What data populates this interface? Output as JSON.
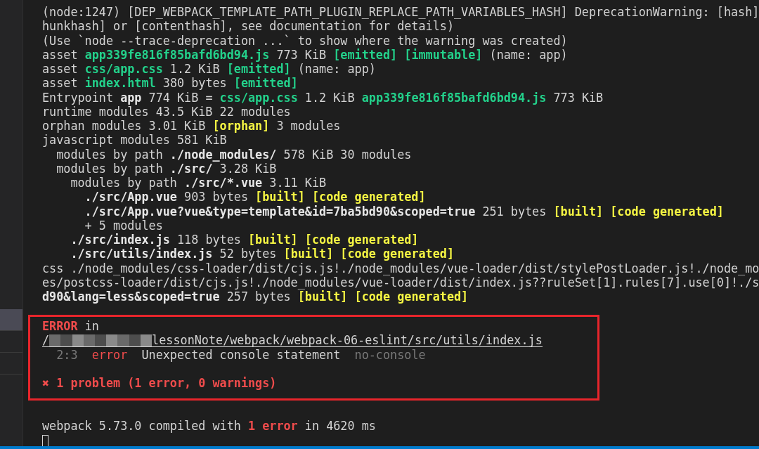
{
  "sidebar": {
    "items": [
      {
        "selected": true
      },
      {
        "selected": false
      },
      {
        "selected": false
      }
    ]
  },
  "terminal": {
    "output": [
      {
        "segments": [
          {
            "text": "(node:1247) [DEP_WEBPACK_TEMPLATE_PATH_PLUGIN_REPLACE_PATH_VARIABLES_HASH] DeprecationWarning: [hash]",
            "kind": "plain"
          }
        ]
      },
      {
        "segments": [
          {
            "text": "hunkhash] or [contenthash], see documentation for details)",
            "kind": "plain"
          }
        ]
      },
      {
        "segments": [
          {
            "text": "(Use `node --trace-deprecation ...` to show where the warning was created)",
            "kind": "plain"
          }
        ]
      },
      {
        "segments": [
          {
            "text": "asset ",
            "kind": "plain"
          },
          {
            "text": "app339fe816f85bafd6bd94.js",
            "kind": "green"
          },
          {
            "text": " 773 KiB ",
            "kind": "plain"
          },
          {
            "text": "[emitted] [immutable]",
            "kind": "green"
          },
          {
            "text": " (name: app)",
            "kind": "plain"
          }
        ]
      },
      {
        "segments": [
          {
            "text": "asset ",
            "kind": "plain"
          },
          {
            "text": "css/app.css",
            "kind": "green"
          },
          {
            "text": " 1.2 KiB ",
            "kind": "plain"
          },
          {
            "text": "[emitted]",
            "kind": "green"
          },
          {
            "text": " (name: app)",
            "kind": "plain"
          }
        ]
      },
      {
        "segments": [
          {
            "text": "asset ",
            "kind": "plain"
          },
          {
            "text": "index.html",
            "kind": "green"
          },
          {
            "text": " 380 bytes ",
            "kind": "plain"
          },
          {
            "text": "[emitted]",
            "kind": "green"
          }
        ]
      },
      {
        "segments": [
          {
            "text": "Entrypoint ",
            "kind": "plain"
          },
          {
            "text": "app",
            "kind": "bold"
          },
          {
            "text": " 774 KiB = ",
            "kind": "plain"
          },
          {
            "text": "css/app.css",
            "kind": "green"
          },
          {
            "text": " 1.2 KiB ",
            "kind": "plain"
          },
          {
            "text": "app339fe816f85bafd6bd94.js",
            "kind": "green"
          },
          {
            "text": " 773 KiB",
            "kind": "plain"
          }
        ]
      },
      {
        "segments": [
          {
            "text": "runtime modules 43.5 KiB 22 modules",
            "kind": "plain"
          }
        ]
      },
      {
        "segments": [
          {
            "text": "orphan modules 3.01 KiB ",
            "kind": "plain"
          },
          {
            "text": "[orphan]",
            "kind": "yellow"
          },
          {
            "text": " 3 modules",
            "kind": "plain"
          }
        ]
      },
      {
        "segments": [
          {
            "text": "javascript modules 581 KiB",
            "kind": "plain"
          }
        ],
        "children": [
          {
            "segments": [
              {
                "text": "modules by path ",
                "kind": "plain"
              },
              {
                "text": "./node_modules/",
                "kind": "bold"
              },
              {
                "text": " 578 KiB 30 modules",
                "kind": "plain"
              }
            ]
          },
          {
            "segments": [
              {
                "text": "modules by path ",
                "kind": "plain"
              },
              {
                "text": "./src/",
                "kind": "bold"
              },
              {
                "text": " 3.28 KiB",
                "kind": "plain"
              }
            ],
            "children": [
              {
                "segments": [
                  {
                    "text": "modules by path ",
                    "kind": "plain"
                  },
                  {
                    "text": "./src/*.vue",
                    "kind": "bold"
                  },
                  {
                    "text": " 3.11 KiB",
                    "kind": "plain"
                  }
                ],
                "children": [
                  {
                    "segments": [
                      {
                        "text": "./src/App.vue",
                        "kind": "bold"
                      },
                      {
                        "text": " 903 bytes ",
                        "kind": "plain"
                      },
                      {
                        "text": "[built] [code generated]",
                        "kind": "yellow"
                      }
                    ]
                  },
                  {
                    "segments": [
                      {
                        "text": "./src/App.vue?vue&type=template&id=7ba5bd90&scoped=true",
                        "kind": "bold"
                      },
                      {
                        "text": " 251 bytes ",
                        "kind": "plain"
                      },
                      {
                        "text": "[built] [code generated]",
                        "kind": "yellow"
                      }
                    ]
                  },
                  {
                    "segments": [
                      {
                        "text": "+ 5 modules",
                        "kind": "plain"
                      }
                    ]
                  }
                ]
              },
              {
                "segments": [
                  {
                    "text": "./src/index.js",
                    "kind": "bold"
                  },
                  {
                    "text": " 118 bytes ",
                    "kind": "plain"
                  },
                  {
                    "text": "[built] [code generated]",
                    "kind": "yellow"
                  }
                ]
              },
              {
                "segments": [
                  {
                    "text": "./src/utils/index.js",
                    "kind": "bold"
                  },
                  {
                    "text": " 52 bytes ",
                    "kind": "plain"
                  },
                  {
                    "text": "[built] [code generated]",
                    "kind": "yellow"
                  }
                ]
              }
            ]
          }
        ]
      },
      {
        "segments": [
          {
            "text": "css ./node_modules/css-loader/dist/cjs.js!./node_modules/vue-loader/dist/stylePostLoader.js!./node_mo",
            "kind": "plain"
          }
        ]
      },
      {
        "segments": [
          {
            "text": "es/postcss-loader/dist/cjs.js!./node_modules/vue-loader/dist/index.js??ruleSet[1].rules[7].use[0]!./s",
            "kind": "plain"
          }
        ]
      },
      {
        "segments": [
          {
            "text": "d90&lang=less&scoped=true",
            "kind": "bold"
          },
          {
            "text": " 257 bytes ",
            "kind": "plain"
          },
          {
            "text": "[built] [code generated]",
            "kind": "yellow"
          }
        ]
      }
    ],
    "error_box": {
      "heading": [
        {
          "text": "ERROR",
          "kind": "red"
        },
        {
          "text": " in",
          "kind": "plain"
        }
      ],
      "path": {
        "before_redaction": "/",
        "after_redaction": "lessonNote/webpack/webpack-06-eslint/src/utils/index.js"
      },
      "problem": [
        {
          "text": "2:3",
          "kind": "dim"
        },
        {
          "text": "  error",
          "kind": "red-plain"
        },
        {
          "text": "  Unexpected console statement  ",
          "kind": "plain"
        },
        {
          "text": "no-console",
          "kind": "dim"
        }
      ],
      "summary": [
        {
          "text": "✖ 1 problem (1 error, 0 warnings)",
          "kind": "red"
        }
      ]
    },
    "result": [
      {
        "text": "webpack 5.73.0 compiled with ",
        "kind": "plain"
      },
      {
        "text": "1 error",
        "kind": "red"
      },
      {
        "text": " in 4620 ms",
        "kind": "plain"
      }
    ],
    "cursor": true
  }
}
